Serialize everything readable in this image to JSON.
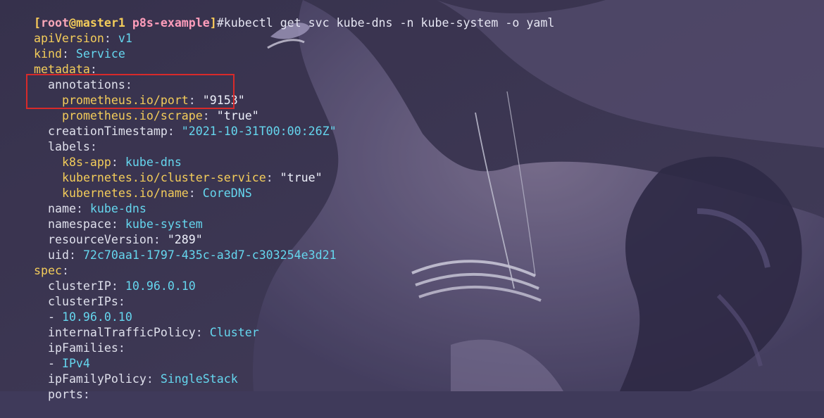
{
  "prompt": {
    "bracket_open": "[",
    "user": "root",
    "at": "@",
    "host": "master1",
    "space": " ",
    "cwd": "p8s-example",
    "bracket_close": "]",
    "command": "#kubectl get svc kube-dns -n kube-system -o yaml"
  },
  "yaml": {
    "apiVersion_key": "apiVersion",
    "apiVersion_value": "v1",
    "kind_key": "kind",
    "kind_value": "Service",
    "metadata_key": "metadata",
    "annotations_key": "annotations",
    "prom_port_key": "prometheus.io/port",
    "prom_port_value": "\"9153\"",
    "prom_scrape_key": "prometheus.io/scrape",
    "prom_scrape_value": "\"true\"",
    "creationTimestamp_key": "creationTimestamp",
    "creationTimestamp_value": "\"2021-10-31T00:00:26Z\"",
    "labels_key": "labels",
    "k8s_app_key": "k8s-app",
    "k8s_app_value": "kube-dns",
    "cluster_service_key": "kubernetes.io/cluster-service",
    "cluster_service_value": "\"true\"",
    "k8s_name_key": "kubernetes.io/name",
    "k8s_name_value": "CoreDNS",
    "name_key": "name",
    "name_value": "kube-dns",
    "namespace_key": "namespace",
    "namespace_value": "kube-system",
    "resourceVersion_key": "resourceVersion",
    "resourceVersion_value": "\"289\"",
    "uid_key": "uid",
    "uid_value": "72c70aa1-1797-435c-a3d7-c303254e3d21",
    "spec_key": "spec",
    "clusterIP_key": "clusterIP",
    "clusterIP_value": "10.96.0.10",
    "clusterIPs_key": "clusterIPs",
    "clusterIPs_item": "10.96.0.10",
    "internalTrafficPolicy_key": "internalTrafficPolicy",
    "internalTrafficPolicy_value": "Cluster",
    "ipFamilies_key": "ipFamilies",
    "ipFamilies_item": "IPv4",
    "ipFamilyPolicy_key": "ipFamilyPolicy",
    "ipFamilyPolicy_value": "SingleStack",
    "ports_key": "ports"
  },
  "colors": {
    "background": "#3f3a5a",
    "key_top": "#f3cc5a",
    "key_nested": "#dfe0ec",
    "value": "#65d6ee",
    "string": "#eef0fb",
    "highlight_border": "#d82a2a"
  }
}
